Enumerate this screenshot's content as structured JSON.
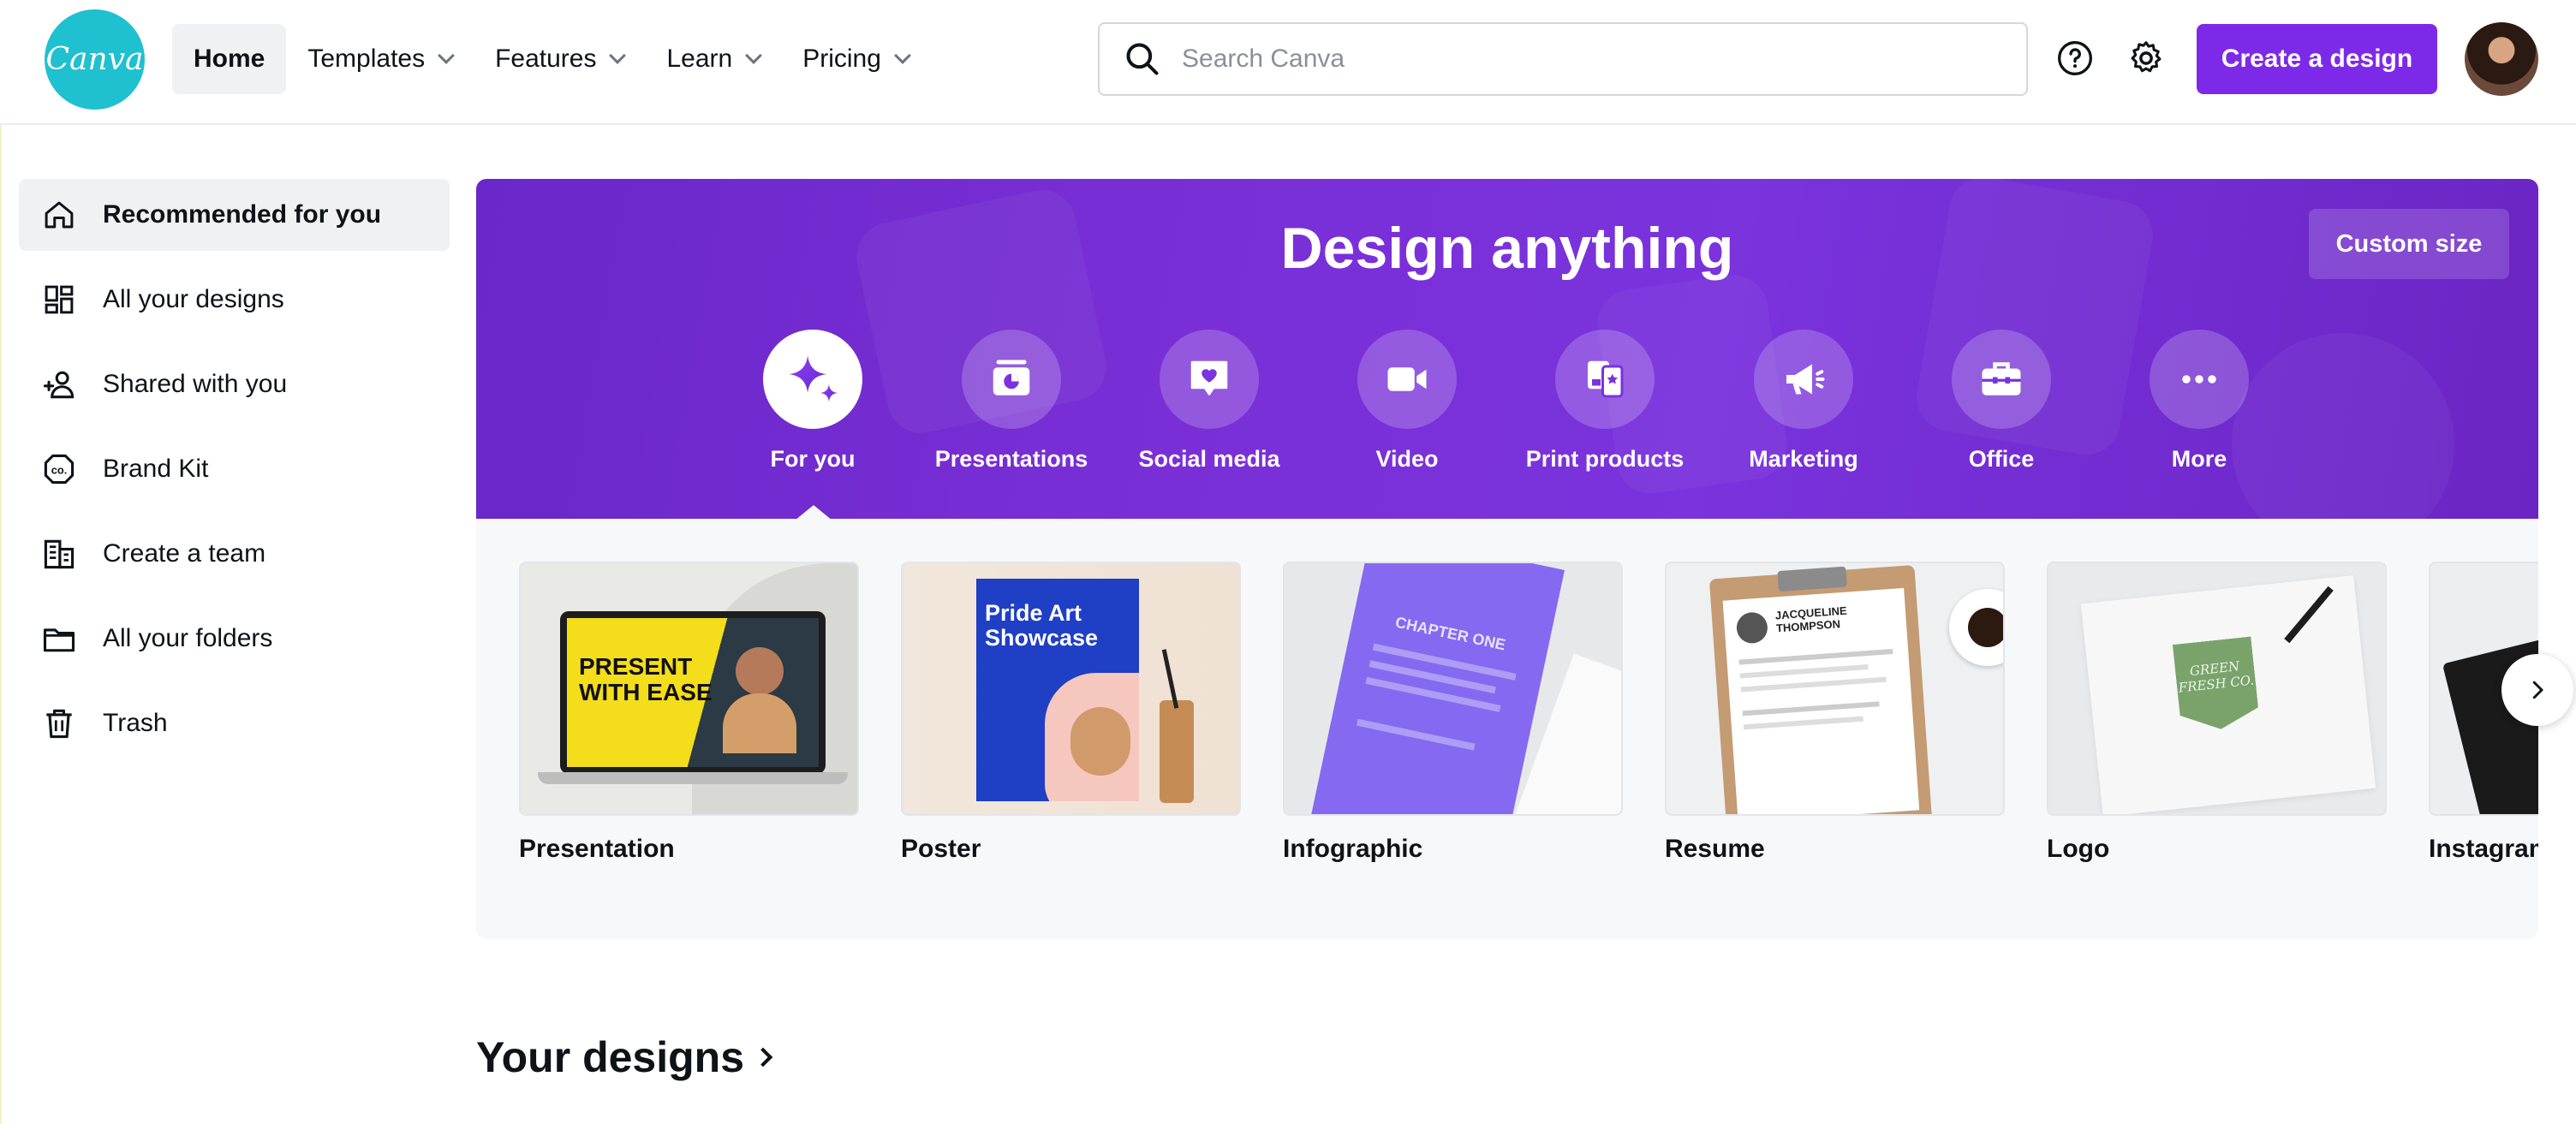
{
  "header": {
    "logo_text": "Canva",
    "nav": [
      {
        "label": "Home",
        "active": true,
        "dropdown": false
      },
      {
        "label": "Templates",
        "active": false,
        "dropdown": true
      },
      {
        "label": "Features",
        "active": false,
        "dropdown": true
      },
      {
        "label": "Learn",
        "active": false,
        "dropdown": true
      },
      {
        "label": "Pricing",
        "active": false,
        "dropdown": true
      }
    ],
    "search_placeholder": "Search Canva",
    "help_icon": "help-circle-icon",
    "settings_icon": "gear-icon",
    "create_button": "Create a design",
    "accent_color": "#7d2ae8"
  },
  "sidebar": {
    "items": [
      {
        "label": "Recommended for you",
        "icon": "home-icon",
        "active": true
      },
      {
        "label": "All your designs",
        "icon": "grid-icon",
        "active": false
      },
      {
        "label": "Shared with you",
        "icon": "shared-users-icon",
        "active": false
      },
      {
        "label": "Brand Kit",
        "icon": "brand-kit-icon",
        "active": false
      },
      {
        "label": "Create a team",
        "icon": "building-icon",
        "active": false
      },
      {
        "label": "All your folders",
        "icon": "folder-icon",
        "active": false
      },
      {
        "label": "Trash",
        "icon": "trash-icon",
        "active": false
      }
    ]
  },
  "hero": {
    "title": "Design anything",
    "custom_size": "Custom size",
    "categories": [
      {
        "label": "For you",
        "icon": "sparkle-icon",
        "active": true
      },
      {
        "label": "Presentations",
        "icon": "presentation-icon",
        "active": false
      },
      {
        "label": "Social media",
        "icon": "heart-chat-icon",
        "active": false
      },
      {
        "label": "Video",
        "icon": "video-camera-icon",
        "active": false
      },
      {
        "label": "Print products",
        "icon": "print-products-icon",
        "active": false
      },
      {
        "label": "Marketing",
        "icon": "megaphone-icon",
        "active": false
      },
      {
        "label": "Office",
        "icon": "briefcase-icon",
        "active": false
      },
      {
        "label": "More",
        "icon": "more-dots-icon",
        "active": false
      }
    ]
  },
  "templates": [
    {
      "label": "Presentation",
      "thumb_text": [
        "PRESENT",
        "WITH EASE"
      ]
    },
    {
      "label": "Poster",
      "thumb_text": [
        "Pride Art",
        "Showcase"
      ]
    },
    {
      "label": "Infographic",
      "thumb_text": [
        "CHAPTER ONE"
      ]
    },
    {
      "label": "Resume",
      "thumb_text": [
        "JACQUELINE",
        "THOMPSON"
      ]
    },
    {
      "label": "Logo",
      "thumb_text": [
        "GREEN",
        "FRESH CO."
      ]
    },
    {
      "label": "Instagram Post",
      "thumb_text": []
    }
  ],
  "your_designs": {
    "title": "Your designs"
  }
}
